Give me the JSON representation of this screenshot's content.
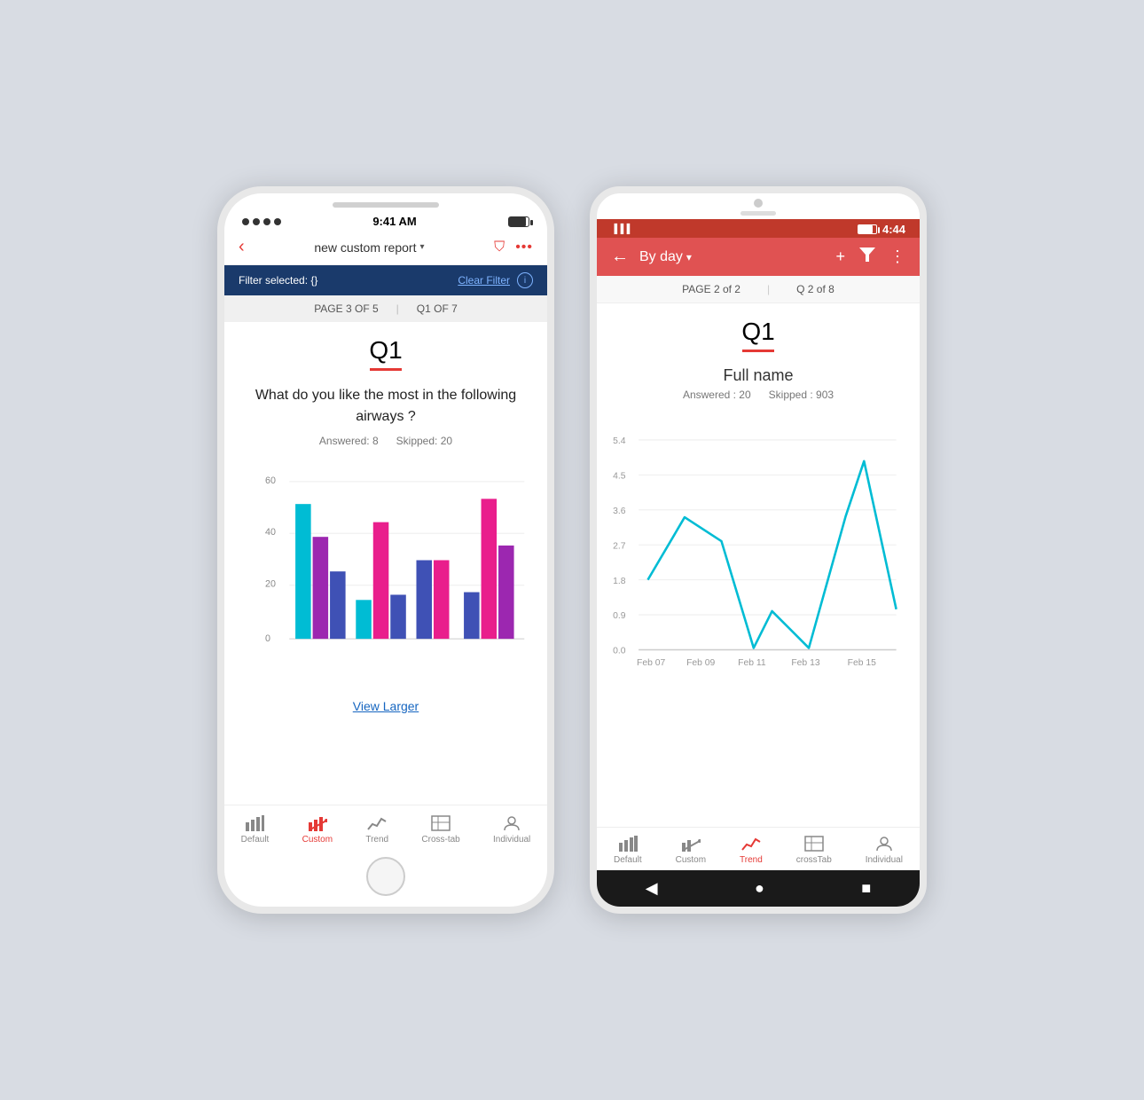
{
  "iphone": {
    "status": {
      "time": "9:41 AM"
    },
    "header": {
      "back": "‹",
      "title": "new custom report",
      "chevron": "▾"
    },
    "filter_bar": {
      "text": "Filter selected: {}",
      "clear": "Clear Filter",
      "info": "i"
    },
    "pagination": {
      "page": "PAGE 3  OF 5",
      "sep": "|",
      "q": "Q1  OF 7"
    },
    "question": {
      "number": "Q1",
      "text": "What do you like the most in the following airways ?",
      "answered_label": "Answered:",
      "answered_value": "8",
      "skipped_label": "Skipped:",
      "skipped_value": "20"
    },
    "view_larger": "View Larger",
    "tabs": [
      {
        "id": "default",
        "label": "Default",
        "active": false
      },
      {
        "id": "custom",
        "label": "Custom",
        "active": true
      },
      {
        "id": "trend",
        "label": "Trend",
        "active": false
      },
      {
        "id": "crosstab",
        "label": "Cross-tab",
        "active": false
      },
      {
        "id": "individual",
        "label": "Individual",
        "active": false
      }
    ],
    "chart": {
      "y_labels": [
        "60",
        "40",
        "20",
        "0"
      ],
      "colors": {
        "cyan": "#00bcd4",
        "pink": "#e91e8c",
        "blue": "#3f51b5",
        "purple": "#9c27b0"
      },
      "groups": [
        {
          "bars": [
            58,
            44,
            29
          ]
        },
        {
          "bars": [
            17,
            50,
            19
          ]
        },
        {
          "bars": [
            34,
            34,
            0
          ]
        },
        {
          "bars": [
            20,
            60,
            40
          ]
        }
      ]
    }
  },
  "android": {
    "status": {
      "time": "4:44"
    },
    "toolbar": {
      "back": "←",
      "title": "By day",
      "chevron": "▾",
      "add": "+",
      "filter": "▼",
      "more": "⋮"
    },
    "pagination": {
      "page": "PAGE 2 of 2",
      "sep": "|",
      "q": "Q 2 of 8"
    },
    "question": {
      "number": "Q1",
      "title": "Full name",
      "answered_label": "Answered : 20",
      "skipped_label": "Skipped : 903"
    },
    "chart": {
      "y_labels": [
        "5.4",
        "4.5",
        "3.6",
        "2.7",
        "1.8",
        "0.9",
        "0.0"
      ],
      "x_labels": [
        "Feb 07",
        "Feb 09",
        "Feb 11",
        "Feb 13",
        "Feb 15"
      ],
      "line_color": "#00bcd4",
      "data_points": [
        {
          "x": 0,
          "y": 1.8
        },
        {
          "x": 1,
          "y": 3.7
        },
        {
          "x": 2,
          "y": 2.8
        },
        {
          "x": 3,
          "y": 0.05
        },
        {
          "x": 3.5,
          "y": 0.9
        },
        {
          "x": 4,
          "y": 0.05
        },
        {
          "x": 5,
          "y": 3.5
        },
        {
          "x": 6,
          "y": 4.8
        },
        {
          "x": 7,
          "y": 0.9
        }
      ]
    },
    "tabs": [
      {
        "id": "default",
        "label": "Default",
        "active": false
      },
      {
        "id": "custom",
        "label": "Custom",
        "active": false
      },
      {
        "id": "trend",
        "label": "Trend",
        "active": true
      },
      {
        "id": "crosstab",
        "label": "crossTab",
        "active": false
      },
      {
        "id": "individual",
        "label": "Individual",
        "active": false
      }
    ],
    "nav": {
      "back": "◀",
      "home": "●",
      "square": "■"
    }
  }
}
